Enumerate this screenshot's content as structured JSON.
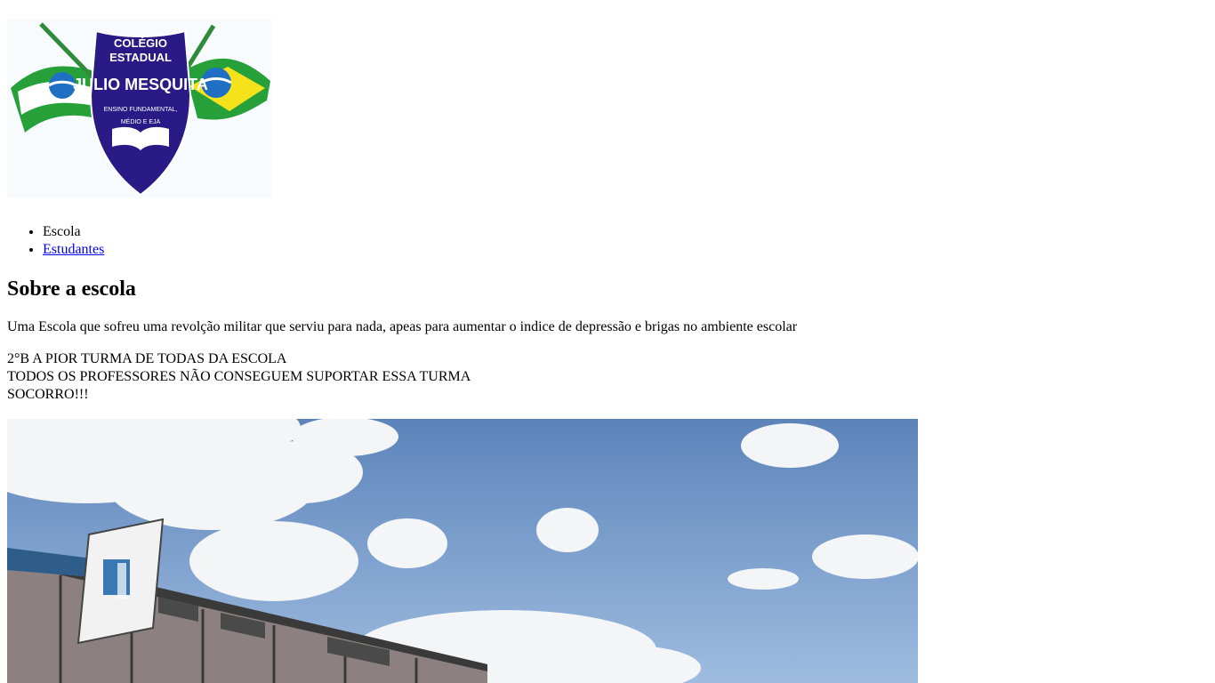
{
  "logo": {
    "line1": "COLÉGIO",
    "line2": "ESTADUAL",
    "name": "JULIO MESQUITA",
    "sub1": "ENSINO FUNDAMENTAL,",
    "sub2": "MÉDIO E EJA"
  },
  "nav": {
    "items": [
      {
        "label": "Escola",
        "link": false
      },
      {
        "label": "Estudantes",
        "link": true
      }
    ]
  },
  "main": {
    "heading": "Sobre a escola",
    "description": "Uma Escola que sofreu uma revolção militar que serviu para nada, apeas para aumentar o indice de depressão e brigas no ambiente escolar",
    "lines": [
      "2°B A PIOR TURMA DE TODAS DA ESCOLA",
      "TODOS OS PROFESSORES NÃO CONSEGUEM SUPORTAR ESSA TURMA",
      "SOCORRO!!!"
    ]
  },
  "colors": {
    "link": "#0000ee",
    "shield": "#2a1a85",
    "flag_green": "#27a03a",
    "flag_yellow": "#f5e21a",
    "sky_top": "#5c84ba",
    "sky_bottom": "#9fbce0"
  }
}
